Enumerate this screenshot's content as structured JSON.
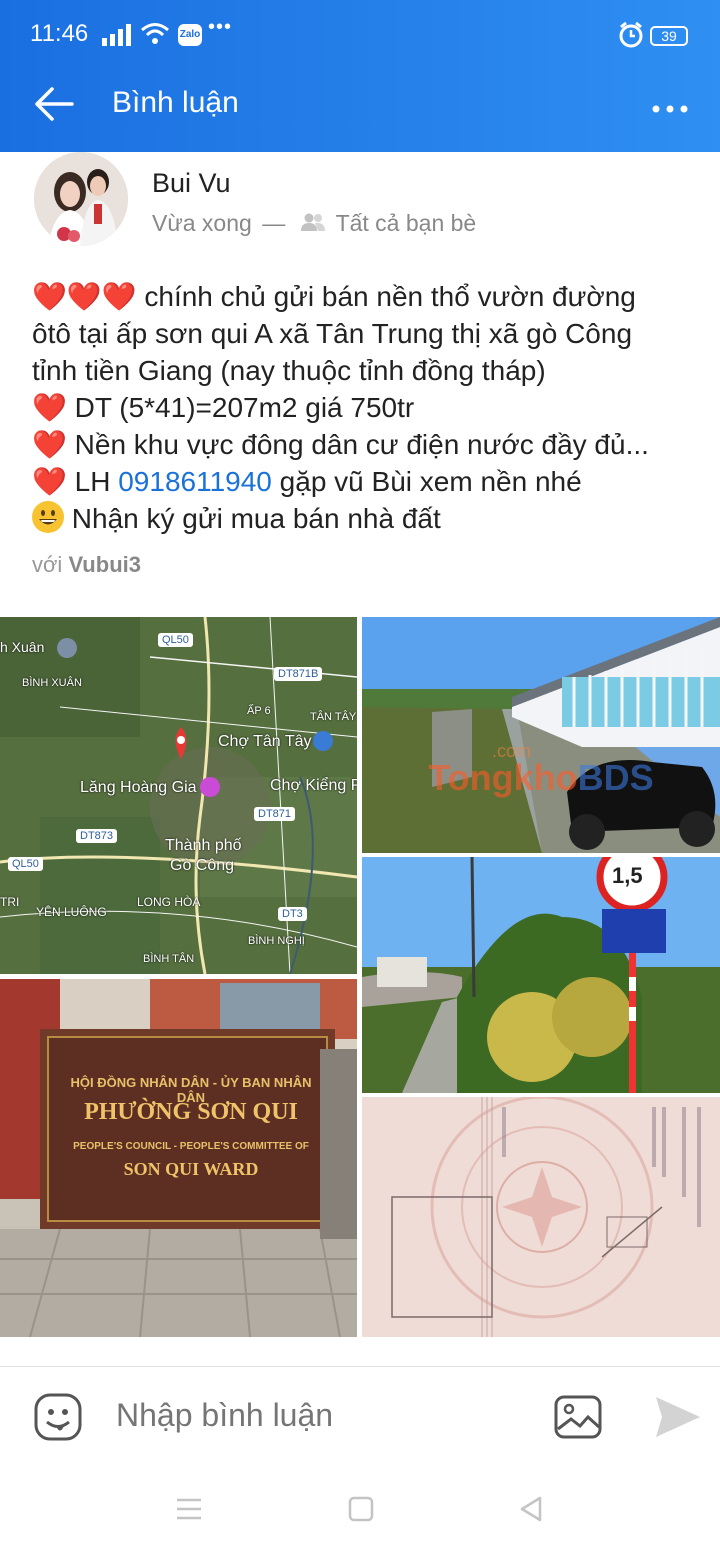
{
  "status": {
    "time": "11:46",
    "zalo": "Zalo",
    "more": "•••",
    "battery": "39"
  },
  "appbar": {
    "title": "Bình luận"
  },
  "post": {
    "author": "Bui Vu",
    "time_label": "Vừa xong",
    "separator": "—",
    "audience": "Tất cả bạn bè",
    "line1_hearts": "❤️❤️❤️",
    "line1_text": " chính chủ gửi bán nền thổ vườn đường",
    "line2": "ôtô tại ấp sơn qui A xã Tân Trung thị xã gò Công",
    "line3": "tỉnh tiền Giang (nay thuộc tỉnh đồng tháp)",
    "line4_text": " DT (5*41)=207m2 giá 750tr",
    "line5_text": " Nền khu vực đông dân cư điện nước đầy đủ...",
    "line6_prefix": " LH ",
    "phone": "0918611940",
    "line6_suffix": " gặp vũ Bùi xem nền nhé",
    "line7_text": " Nhận ký gửi mua bán nhà đất",
    "heart": "❤️",
    "with_label": "với",
    "tagged": "Vubui3"
  },
  "map": {
    "labels": [
      "h Xuân",
      "BÌNH XUÂN",
      "ẤP 6",
      "TÂN TÂY",
      "Chợ Tân Tây",
      "Lăng Hoàng Gia",
      "Chợ Kiểng P",
      "Thành phố",
      "Gò Công",
      "TRI",
      "YÊN LUÔNG",
      "LONG HÒA",
      "BÌNH NGHỊ",
      "BÌNH TÂN"
    ],
    "badges": [
      "QL50",
      "DT871B",
      "DT871",
      "DT873",
      "QL50",
      "DT3"
    ]
  },
  "watermark": {
    "text1": "Tongkho",
    "text2": "BDS",
    "text3": ".com"
  },
  "sign": {
    "line1": "HỘI ĐỒNG NHÂN DÂN - ỦY BAN NHÂN DÂN",
    "line2": "PHƯỜNG SƠN QUI",
    "line3": "PEOPLE'S COUNCIL - PEOPLE'S COMMITTEE OF",
    "line4": "SON QUI WARD"
  },
  "road_sign": {
    "limit": "1,5"
  },
  "comment": {
    "placeholder": "Nhập bình luận"
  },
  "colors": {
    "accent": "#1a6fe0",
    "heart": "#d9131e",
    "link": "#1a72d9"
  }
}
